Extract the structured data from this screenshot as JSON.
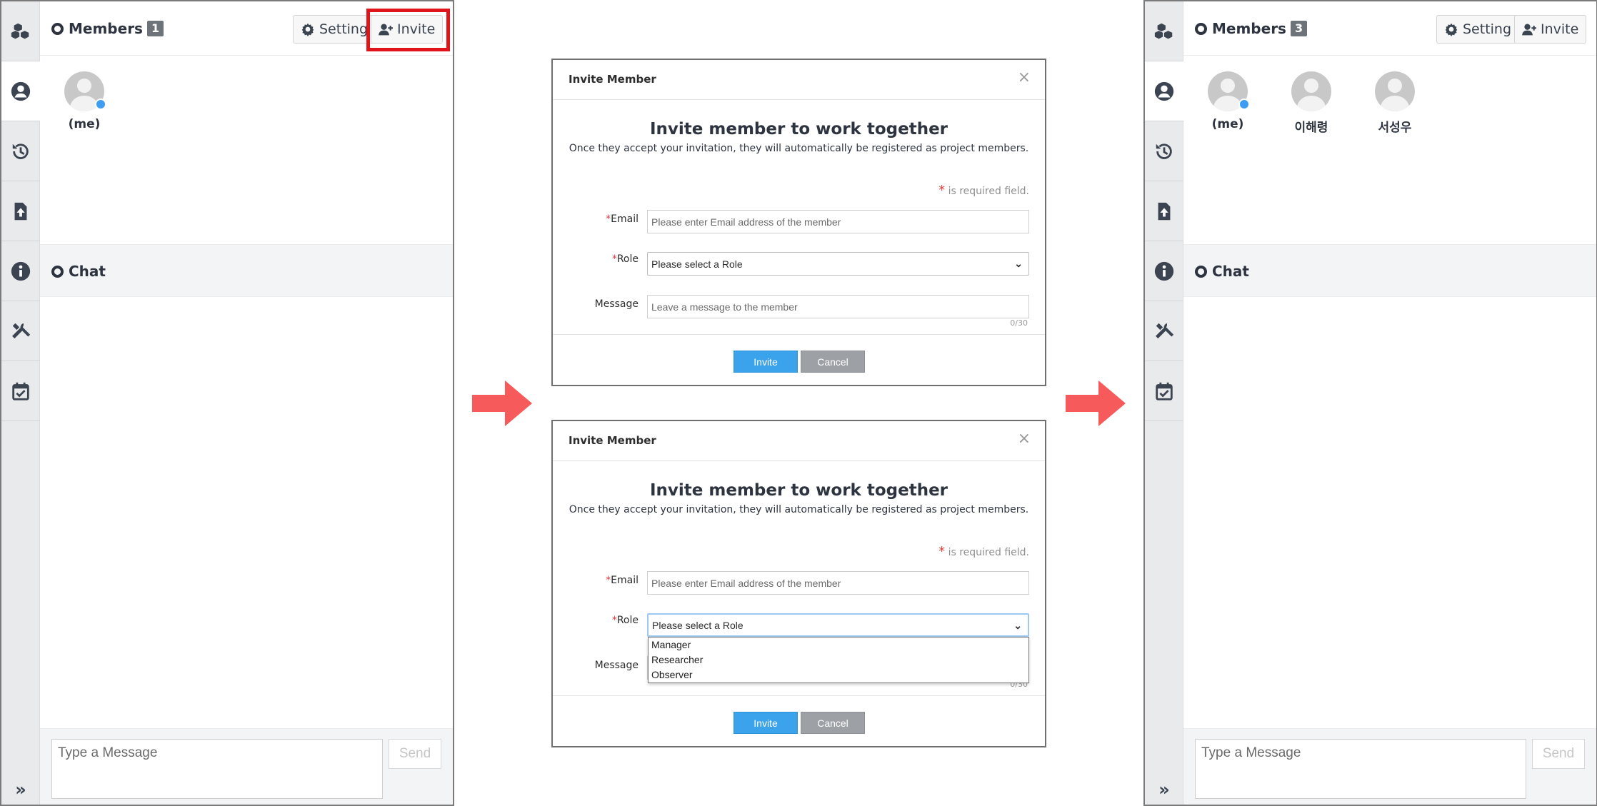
{
  "left_panel": {
    "members_title": "Members",
    "members_count": "1",
    "setting_label": "Setting",
    "invite_label": "Invite",
    "members": [
      {
        "name": "(me)",
        "online": true
      }
    ],
    "chat_title": "Chat",
    "message_placeholder": "Type a Message",
    "send_label": "Send",
    "rail_icons": [
      "cubes-icon",
      "user-circle-icon",
      "history-icon",
      "file-upload-icon",
      "info-icon",
      "tools-icon",
      "calendar-check-icon"
    ],
    "expand_icon": "»"
  },
  "right_panel": {
    "members_title": "Members",
    "members_count": "3",
    "setting_label": "Setting",
    "invite_label": "Invite",
    "members": [
      {
        "name": "(me)",
        "online": true
      },
      {
        "name": "이해령",
        "online": false
      },
      {
        "name": "서성우",
        "online": false
      }
    ],
    "chat_title": "Chat",
    "message_placeholder": "Type a Message",
    "send_label": "Send",
    "expand_icon": "»"
  },
  "modal": {
    "title": "Invite Member",
    "close": "×",
    "heading": "Invite member to work together",
    "subheading": "Once they accept your invitation, they will automatically be registered as project members.",
    "required_star": "*",
    "required_note": " is required field.",
    "email_label": "Email",
    "email_placeholder": "Please enter Email address of the member",
    "role_label": "Role",
    "role_placeholder": "Please select a Role",
    "message_label": "Message",
    "message_placeholder": "Leave a message to the member",
    "counter": "0/30",
    "invite_button": "Invite",
    "cancel_button": "Cancel",
    "role_options": [
      "Manager",
      "Researcher",
      "Observer"
    ]
  },
  "colors": {
    "highlight": "#e0151b",
    "arrow": "#f65a5a",
    "primary": "#3ba3ec",
    "online": "#3d9df2"
  }
}
